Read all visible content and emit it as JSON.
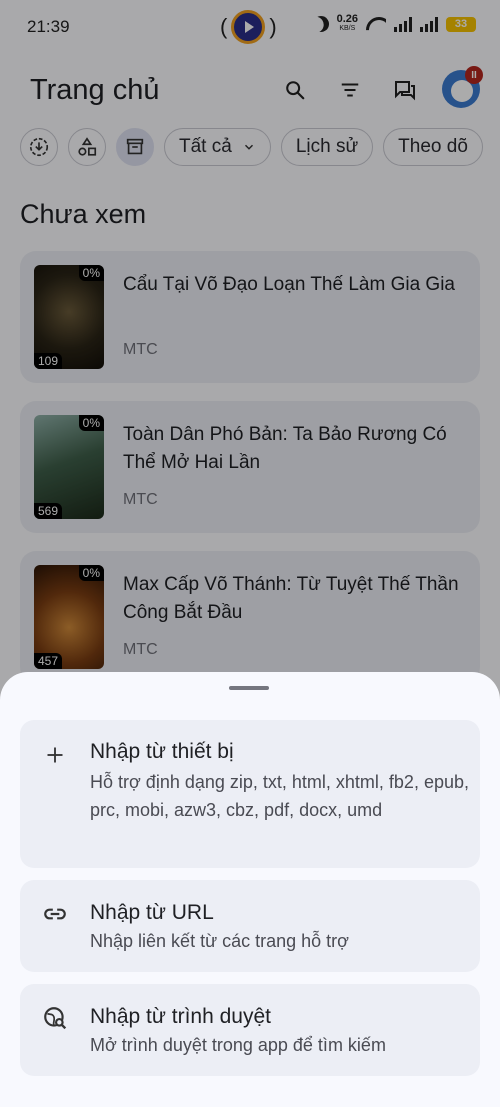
{
  "status": {
    "time": "21:39",
    "net_speed": "0.26",
    "net_unit": "KB/S",
    "battery": "33"
  },
  "header": {
    "title": "Trang chủ",
    "avatar_badge": "II"
  },
  "filters": {
    "all_label": "Tất cả",
    "history_label": "Lịch sử",
    "follow_label": "Theo dõ"
  },
  "section": {
    "title": "Chưa xem"
  },
  "books": [
    {
      "title": "Cẩu Tại Võ Đạo Loạn Thế Làm Gia Gia",
      "source": "MTC",
      "progress": "0%",
      "chapters": "109"
    },
    {
      "title": "Toàn Dân Phó Bản: Ta Bảo Rương Có Thể Mở Hai Lần",
      "source": "MTC",
      "progress": "0%",
      "chapters": "569"
    },
    {
      "title": "Max Cấp Võ Thánh: Từ Tuyệt Thế Thần Công Bắt Đầu",
      "source": "MTC",
      "progress": "0%",
      "chapters": "457"
    }
  ],
  "sheet": {
    "options": [
      {
        "title": "Nhập từ thiết bị",
        "subtitle": "Hỗ trợ định dạng zip, txt, html, xhtml, fb2, epub, prc, mobi, azw3, cbz, pdf, docx, umd",
        "icon": "plus-icon"
      },
      {
        "title": "Nhập từ URL",
        "subtitle": "Nhập liên kết từ các trang hỗ trợ",
        "icon": "link-icon"
      },
      {
        "title": "Nhập từ trình duyệt",
        "subtitle": "Mở trình duyệt trong app để tìm kiếm",
        "icon": "globe-search-icon"
      }
    ]
  }
}
